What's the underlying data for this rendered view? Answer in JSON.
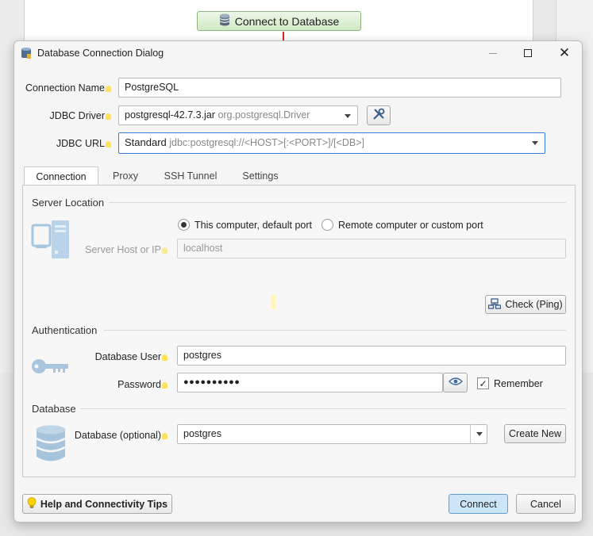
{
  "background": {
    "connect_button_label": "Connect to Database"
  },
  "dialog": {
    "title": "Database Connection Dialog",
    "connection_name": {
      "label": "Connection Name",
      "value": "PostgreSQL"
    },
    "jdbc_driver": {
      "label": "JDBC Driver",
      "jar": "postgresql-42.7.3.jar",
      "class": "org.postgresql.Driver"
    },
    "jdbc_url": {
      "label": "JDBC URL",
      "type": "Standard",
      "template": "jdbc:postgresql://<HOST>[:<PORT>]/[<DB>]"
    },
    "tabs": [
      "Connection",
      "Proxy",
      "SSH Tunnel",
      "Settings"
    ],
    "server_location": {
      "title": "Server Location",
      "radio_local": "This computer, default port",
      "radio_remote": "Remote computer or custom port",
      "host_label": "Server Host or IP",
      "host_value": "localhost",
      "check_button": "Check (Ping)"
    },
    "authentication": {
      "title": "Authentication",
      "user_label": "Database User",
      "user_value": "postgres",
      "password_label": "Password",
      "password_value": "●●●●●●●●●●",
      "remember_label": "Remember"
    },
    "database": {
      "title": "Database",
      "db_label": "Database (optional)",
      "db_value": "postgres",
      "create_button": "Create New"
    },
    "footer": {
      "help_button": "Help and Connectivity Tips",
      "connect_button": "Connect",
      "cancel_button": "Cancel"
    }
  },
  "colors": {
    "accent": "#cde6f7",
    "arrow": "#e02020",
    "hint": "#ffe15a"
  }
}
